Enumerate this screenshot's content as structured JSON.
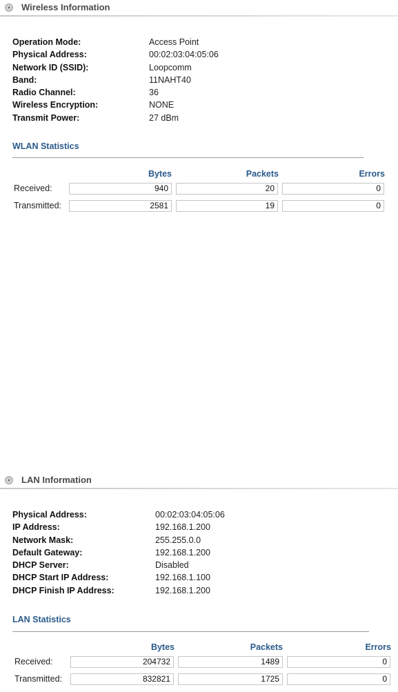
{
  "wireless": {
    "header": "Wireless Information",
    "fields": [
      {
        "label": "Operation Mode:",
        "value": "Access Point"
      },
      {
        "label": "Physical Address:",
        "value": "00:02:03:04:05:06"
      },
      {
        "label": "Network ID (SSID):",
        "value": "Loopcomm"
      },
      {
        "label": "Band:",
        "value": "11NAHT40"
      },
      {
        "label": "Radio Channel:",
        "value": "36"
      },
      {
        "label": "Wireless Encryption:",
        "value": "NONE"
      },
      {
        "label": "Transmit Power:",
        "value": "27 dBm"
      }
    ],
    "stats": {
      "title": "WLAN Statistics",
      "columns": [
        "Bytes",
        "Packets",
        "Errors"
      ],
      "rows": [
        {
          "label": "Received:",
          "bytes": "940",
          "packets": "20",
          "errors": "0"
        },
        {
          "label": "Transmitted:",
          "bytes": "2581",
          "packets": "19",
          "errors": "0"
        }
      ]
    }
  },
  "lan": {
    "header": "LAN Information",
    "fields": [
      {
        "label": "Physical Address:",
        "value": "00:02:03:04:05:06"
      },
      {
        "label": "IP Address:",
        "value": "192.168.1.200"
      },
      {
        "label": "Network Mask:",
        "value": "255.255.0.0"
      },
      {
        "label": "Default Gateway:",
        "value": "192.168.1.200"
      },
      {
        "label": "DHCP Server:",
        "value": "Disabled"
      },
      {
        "label": "DHCP Start IP Address:",
        "value": "192.168.1.100"
      },
      {
        "label": "DHCP Finish IP Address:",
        "value": "192.168.1.200"
      }
    ],
    "stats": {
      "title": "LAN Statistics",
      "columns": [
        "Bytes",
        "Packets",
        "Errors"
      ],
      "rows": [
        {
          "label": "Received:",
          "bytes": "204732",
          "packets": "1489",
          "errors": "0"
        },
        {
          "label": "Transmitted:",
          "bytes": "832821",
          "packets": "1725",
          "errors": "0"
        }
      ]
    }
  },
  "icons": {
    "section_icon": "radio-target-icon"
  },
  "colors": {
    "accent": "#2a5a8a",
    "header_text": "#4a4a4a"
  }
}
